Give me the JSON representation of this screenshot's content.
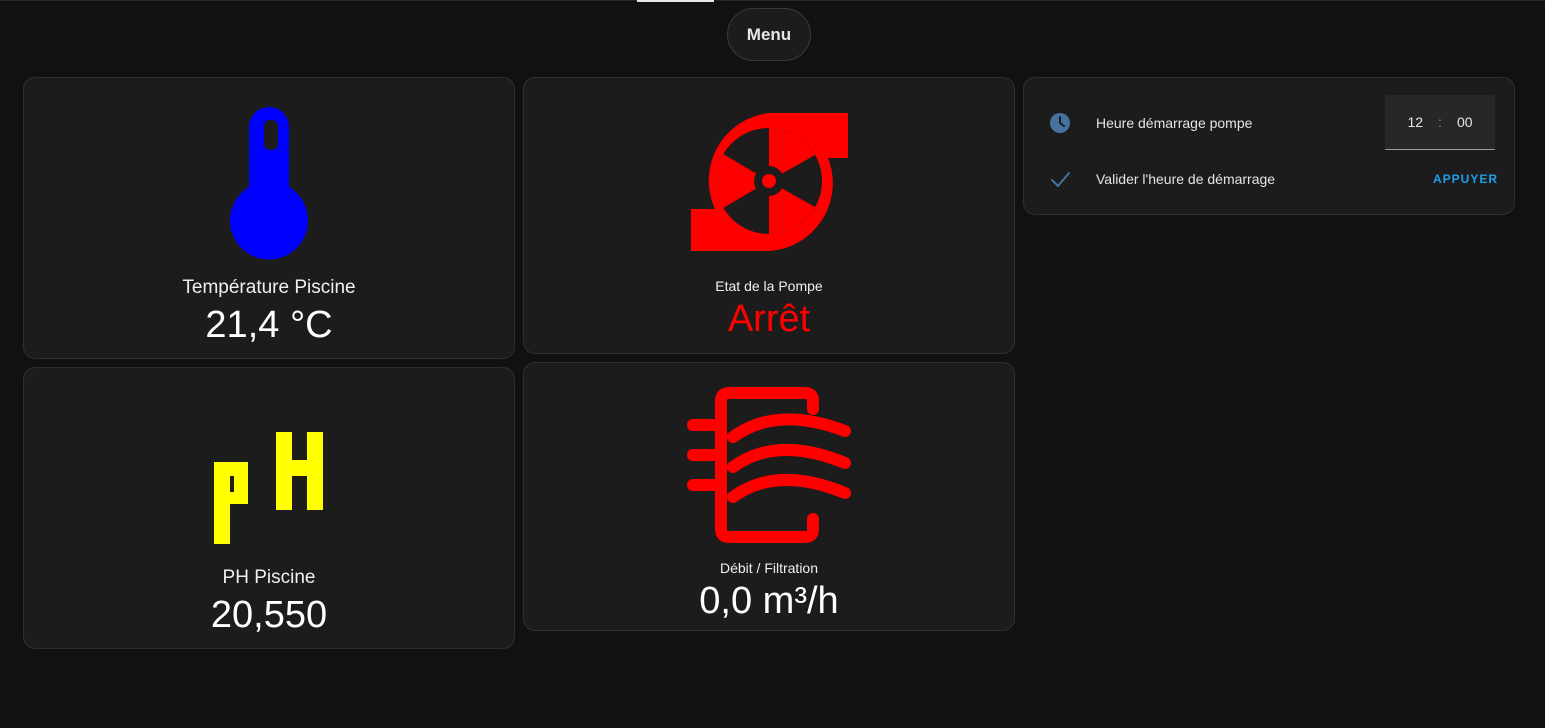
{
  "header": {
    "menu_label": "Menu"
  },
  "cards": {
    "temperature": {
      "label": "Température Piscine",
      "value": "21,4 °C",
      "icon": "thermometer-icon",
      "icon_color": "#0000ff"
    },
    "pump": {
      "label": "Etat de la Pompe",
      "value": "Arrêt",
      "icon": "pump-icon",
      "icon_color": "#ff0000",
      "value_color": "#ff0000"
    },
    "ph": {
      "label": "PH Piscine",
      "value": "20,550",
      "icon": "ph-icon",
      "icon_color": "#ffff00"
    },
    "flow": {
      "label": "Débit / Filtration",
      "value": "0,0 m³/h",
      "icon": "heat-exchanger-icon",
      "icon_color": "#ff0000"
    }
  },
  "settings": {
    "start_time": {
      "label": "Heure démarrage pompe",
      "icon": "clock-icon",
      "hours": "12",
      "separator": ":",
      "minutes": "00"
    },
    "validate": {
      "label": "Valider l'heure de démarrage",
      "icon": "check-icon",
      "button_label": "APPUYER"
    },
    "accent_color": "#1e9ee8",
    "icon_color": "#44739e"
  }
}
